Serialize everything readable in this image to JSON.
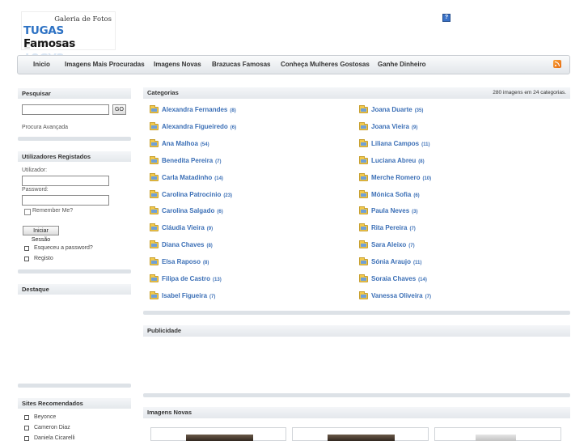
{
  "logo": {
    "tagline": "Galeria de Fotos",
    "brand_a": "TUGAS",
    "brand_b": "Famosas"
  },
  "header": {
    "help_icon": "question-icon"
  },
  "nav": {
    "items": [
      "Inicio",
      "Imagens Mais Procuradas",
      "Imagens Novas",
      "Brazucas Famosas",
      "Conheça Mulheres Gostosas",
      "Ganhe Dinheiro"
    ],
    "rss_icon": "rss-icon"
  },
  "search": {
    "title": "Pesquisar",
    "value": "",
    "button": "GO",
    "advanced": "Procura Avançada"
  },
  "login": {
    "title": "Utilizadores Registados",
    "user_label": "Utilizador:",
    "password_label": "Password:",
    "remember": "Remember Me?",
    "submit": "Iniciar Sessão",
    "forgot": "Esqueceu a password?",
    "register": "Registo"
  },
  "featured": {
    "title": "Destaque"
  },
  "recommended": {
    "title": "Sites Recomendados",
    "items": [
      "Beyonce",
      "Cameron Diaz",
      "Daniela Cicarelli"
    ]
  },
  "categories": {
    "title": "Categorias",
    "summary": "280 imagens em 24 categorias.",
    "left": [
      {
        "name": "Alexandra Fernandes",
        "count": "(8)"
      },
      {
        "name": "Alexandra Figueiredo",
        "count": "(6)"
      },
      {
        "name": "Ana Malhoa",
        "count": "(54)"
      },
      {
        "name": "Benedita Pereira",
        "count": "(7)"
      },
      {
        "name": "Carla Matadinho",
        "count": "(14)"
      },
      {
        "name": "Carolina Patrocinio",
        "count": "(23)"
      },
      {
        "name": "Carolina Salgado",
        "count": "(6)"
      },
      {
        "name": "Cláudia Vieira",
        "count": "(9)"
      },
      {
        "name": "Diana Chaves",
        "count": "(8)"
      },
      {
        "name": "Elsa Raposo",
        "count": "(8)"
      },
      {
        "name": "Filipa de Castro",
        "count": "(13)"
      },
      {
        "name": "Isabel Figueira",
        "count": "(7)"
      }
    ],
    "right": [
      {
        "name": "Joana Duarte",
        "count": "(35)"
      },
      {
        "name": "Joana Vieira",
        "count": "(9)"
      },
      {
        "name": "Liliana Campos",
        "count": "(11)"
      },
      {
        "name": "Luciana Abreu",
        "count": "(8)"
      },
      {
        "name": "Merche Romero",
        "count": "(10)"
      },
      {
        "name": "Mónica Sofia",
        "count": "(6)"
      },
      {
        "name": "Paula Neves",
        "count": "(3)"
      },
      {
        "name": "Rita Pereira",
        "count": "(7)"
      },
      {
        "name": "Sara Aleixo",
        "count": "(7)"
      },
      {
        "name": "Sónia Araujo",
        "count": "(11)"
      },
      {
        "name": "Soraia Chaves",
        "count": "(14)"
      },
      {
        "name": "Vanessa Oliveira",
        "count": "(7)"
      }
    ]
  },
  "ads": {
    "title": "Publicidade"
  },
  "new_images": {
    "title": "Imagens Novas"
  },
  "colors": {
    "link": "#3b6fb6",
    "brand_blue": "#2d72c4",
    "folder": "#f2c94c"
  }
}
